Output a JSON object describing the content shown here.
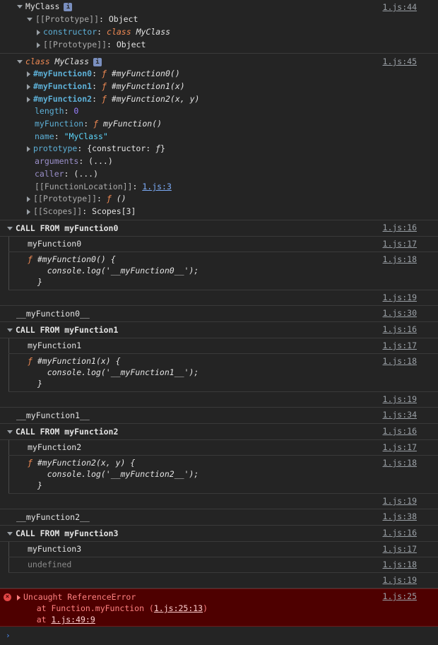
{
  "blocks": {
    "b1": {
      "src": "1.js:44",
      "l1": "MyClass",
      "l2a": "[[Prototype]]",
      "l2b": ": Object",
      "l3a": "constructor",
      "l3b": ": ",
      "l3c": "class",
      "l3d": " MyClass",
      "l4a": "[[Prototype]]",
      "l4b": ": Object"
    },
    "b2": {
      "src": "1.js:45",
      "h_kw": "class",
      "h_name": " MyClass",
      "props": [
        {
          "k": "#myFunction0",
          "f": "ƒ",
          "v": " #myFunction0()"
        },
        {
          "k": "#myFunction1",
          "f": "ƒ",
          "v": " #myFunction1(x)"
        },
        {
          "k": "#myFunction2",
          "f": "ƒ",
          "v": " #myFunction2(x, y)"
        }
      ],
      "length_k": "length",
      "length_v": "0",
      "myfn_k": "myFunction",
      "myfn_f": "ƒ",
      "myfn_v": " myFunction()",
      "name_k": "name",
      "name_v": "\"MyClass\"",
      "proto_k": "prototype",
      "proto_v": ": {constructor: ",
      "proto_f": "ƒ",
      "proto_end": "}",
      "args_k": "arguments",
      "args_v": ": (...)",
      "caller_k": "caller",
      "caller_v": ": (...)",
      "loc_k": "[[FunctionLocation]]",
      "loc_sep": ": ",
      "loc_v": "1.js:3",
      "pp_k": "[[Prototype]]",
      "pp_sep": ": ",
      "pp_f": "ƒ",
      "pp_v": " ()",
      "sc_k": "[[Scopes]]",
      "sc_v": ": Scopes[3]"
    },
    "groups": [
      {
        "title": "CALL FROM myFunction0",
        "src": "1.js:16",
        "name": "myFunction0",
        "name_src": "1.js:17",
        "code1_f": "ƒ",
        "code1": " #myFunction0() {",
        "code2": "    console.log('__myFunction0__');",
        "code3": "}",
        "code_src": "1.js:18",
        "end_src": "1.js:19",
        "out": "__myFunction0__",
        "out_src": "1.js:30"
      },
      {
        "title": "CALL FROM myFunction1",
        "src": "1.js:16",
        "name": "myFunction1",
        "name_src": "1.js:17",
        "code1_f": "ƒ",
        "code1": " #myFunction1(x) {",
        "code2": "    console.log('__myFunction1__');",
        "code3": "}",
        "code_src": "1.js:18",
        "end_src": "1.js:19",
        "out": "__myFunction1__",
        "out_src": "1.js:34"
      },
      {
        "title": "CALL FROM myFunction2",
        "src": "1.js:16",
        "name": "myFunction2",
        "name_src": "1.js:17",
        "code1_f": "ƒ",
        "code1": " #myFunction2(x, y) {",
        "code2": "    console.log('__myFunction2__');",
        "code3": "}",
        "code_src": "1.js:18",
        "end_src": "1.js:19",
        "out": "__myFunction2__",
        "out_src": "1.js:38"
      }
    ],
    "g3": {
      "title": "CALL FROM myFunction3",
      "src": "1.js:16",
      "name": "myFunction3",
      "name_src": "1.js:17",
      "undef": "undefined",
      "undef_src": "1.js:18",
      "end_src": "1.js:19"
    },
    "error": {
      "src": "1.js:25",
      "l1": "Uncaught ReferenceError",
      "l2a": "    at Function.myFunction (",
      "l2b": "1.js:25:13",
      "l2c": ")",
      "l3a": "    at ",
      "l3b": "1.js:49:9"
    },
    "prompt": "›"
  }
}
